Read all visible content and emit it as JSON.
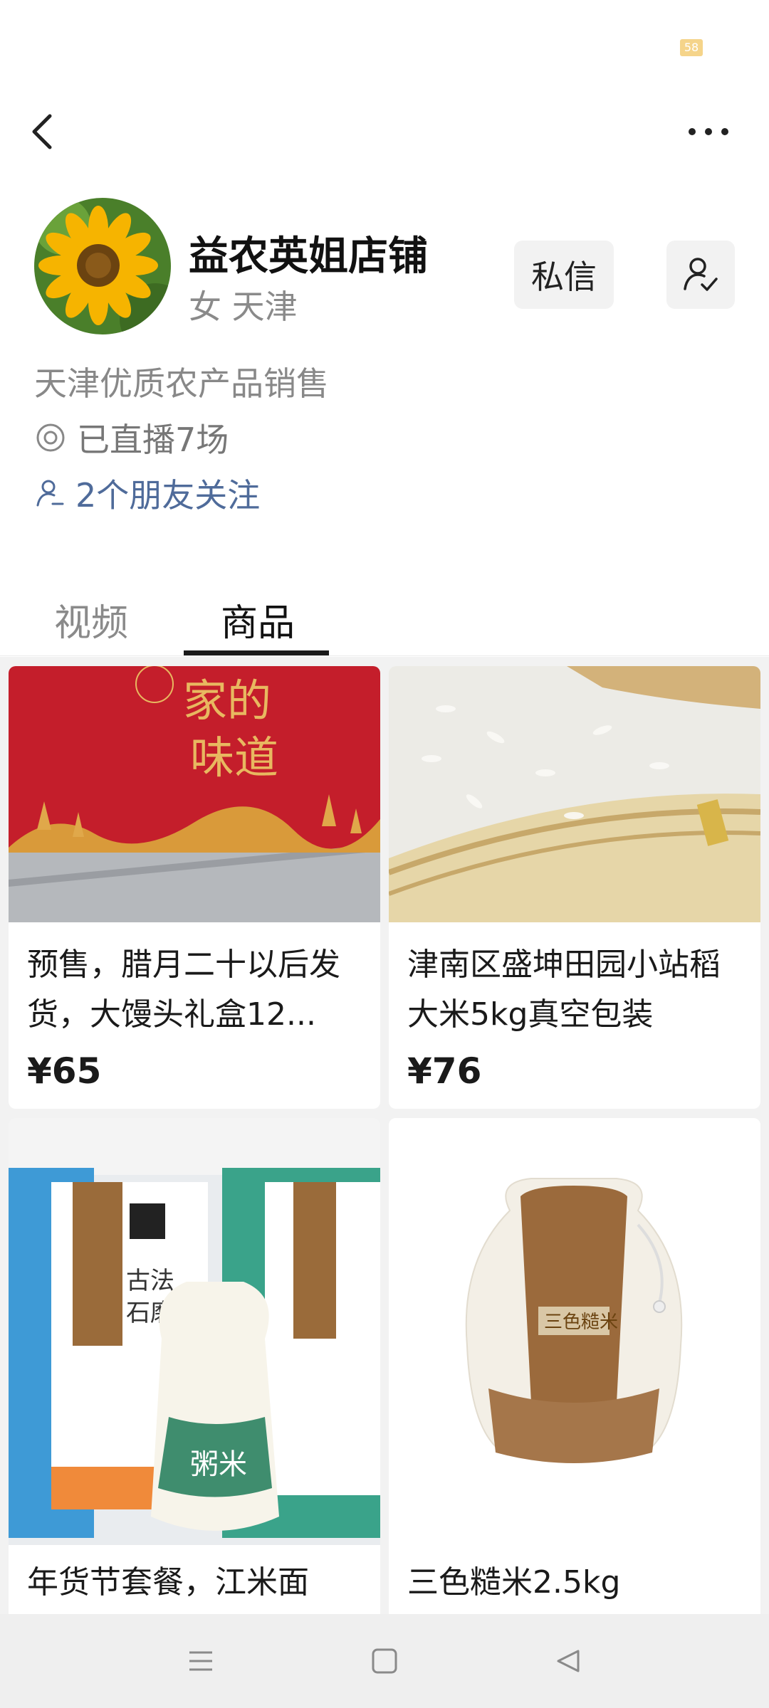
{
  "status_bar": {
    "battery": "58"
  },
  "profile": {
    "shop_name": "益农英姐店铺",
    "meta": "女 天津",
    "message_button": "私信",
    "description": "天津优质农产品销售",
    "live_count": "已直播7场",
    "friends_follow": "2个朋友关注"
  },
  "tabs": [
    {
      "label": "视频",
      "active": false
    },
    {
      "label": "商品",
      "active": true
    }
  ],
  "products": [
    {
      "title": "预售，腊月二十以后发货，大馒头礼盒12...",
      "price": "¥65"
    },
    {
      "title": "津南区盛坤田园小站稻大米5kg真空包装",
      "price": "¥76"
    },
    {
      "title": "年货节套餐，江米面",
      "price": ""
    },
    {
      "title": "三色糙米2.5kg",
      "price": ""
    }
  ],
  "colors": {
    "accent_link": "#4f6b9a",
    "tab_active": "#1a1a1a",
    "grid_bg": "#f2f2f2"
  }
}
